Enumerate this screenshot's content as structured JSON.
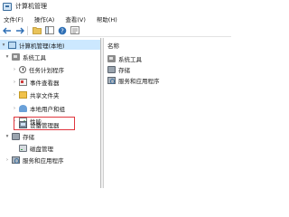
{
  "window": {
    "title": "计算机管理"
  },
  "menu": [
    "文件(F)",
    "操作(A)",
    "查看(V)",
    "帮助(H)"
  ],
  "toolbar": {
    "buttons": [
      "back-arrow-icon",
      "forward-arrow-icon",
      "folder-icon",
      "console-tree-icon",
      "help-icon",
      "properties-icon"
    ]
  },
  "tree": {
    "root": "计算机管理(本地)",
    "system_tools": "系统工具",
    "task_scheduler": "任务计划程序",
    "event_viewer": "事件查看器",
    "shared_folders": "共享文件夹",
    "local_users": "本地用户和组",
    "performance": "性能",
    "device_manager": "设备管理器",
    "storage": "存储",
    "disk_management": "磁盘管理",
    "services_apps": "服务和应用程序"
  },
  "list": {
    "header": "名称",
    "items": [
      "系统工具",
      "存储",
      "服务和应用程序"
    ]
  },
  "colors": {
    "selection": "#cce8ff",
    "highlight_box": "#e0353d",
    "accent": "#3c6e9e"
  }
}
